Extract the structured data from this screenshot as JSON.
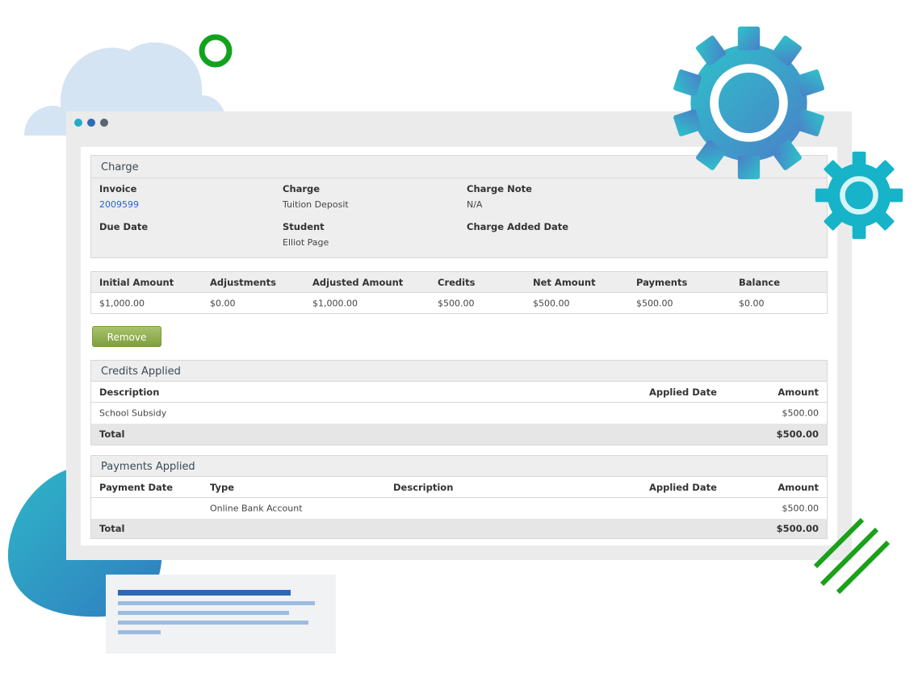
{
  "charge_panel": {
    "title": "Charge",
    "invoice": {
      "label": "Invoice",
      "value": "2009599"
    },
    "charge": {
      "label": "Charge",
      "value": "Tuition Deposit"
    },
    "charge_note": {
      "label": "Charge Note",
      "value": "N/A"
    },
    "due_date": {
      "label": "Due Date",
      "value": ""
    },
    "student": {
      "label": "Student",
      "value": "Elliot Page"
    },
    "charge_added_date": {
      "label": "Charge Added Date",
      "value": ""
    }
  },
  "amounts_table": {
    "headers": [
      "Initial Amount",
      "Adjustments",
      "Adjusted Amount",
      "Credits",
      "Net Amount",
      "Payments",
      "Balance"
    ],
    "values": [
      "$1,000.00",
      "$0.00",
      "$1,000.00",
      "$500.00",
      "$500.00",
      "$500.00",
      "$0.00"
    ]
  },
  "remove_button": {
    "label": "Remove"
  },
  "credits_applied": {
    "title": "Credits Applied",
    "headers": {
      "description": "Description",
      "applied_date": "Applied Date",
      "amount": "Amount"
    },
    "rows": [
      {
        "description": "School Subsidy",
        "applied_date": "",
        "amount": "$500.00"
      }
    ],
    "total_label": "Total",
    "total_amount": "$500.00"
  },
  "payments_applied": {
    "title": "Payments Applied",
    "headers": {
      "payment_date": "Payment Date",
      "type": "Type",
      "description": "Description",
      "applied_date": "Applied Date",
      "amount": "Amount"
    },
    "rows": [
      {
        "payment_date": "",
        "type": "Online Bank Account",
        "description": "",
        "applied_date": "",
        "amount": "$500.00"
      }
    ],
    "total_label": "Total",
    "total_amount": "$500.00"
  },
  "colors": {
    "window_dot_1": "#29a9c8",
    "window_dot_2": "#2f6bb5",
    "window_dot_3": "#5a6670",
    "link": "#2a62c9",
    "remove_button": "#8db04a",
    "accent_green": "#1aa11a"
  },
  "icons": [
    "gear-icon",
    "cloud-icon",
    "circle-icon",
    "stripes-icon"
  ]
}
